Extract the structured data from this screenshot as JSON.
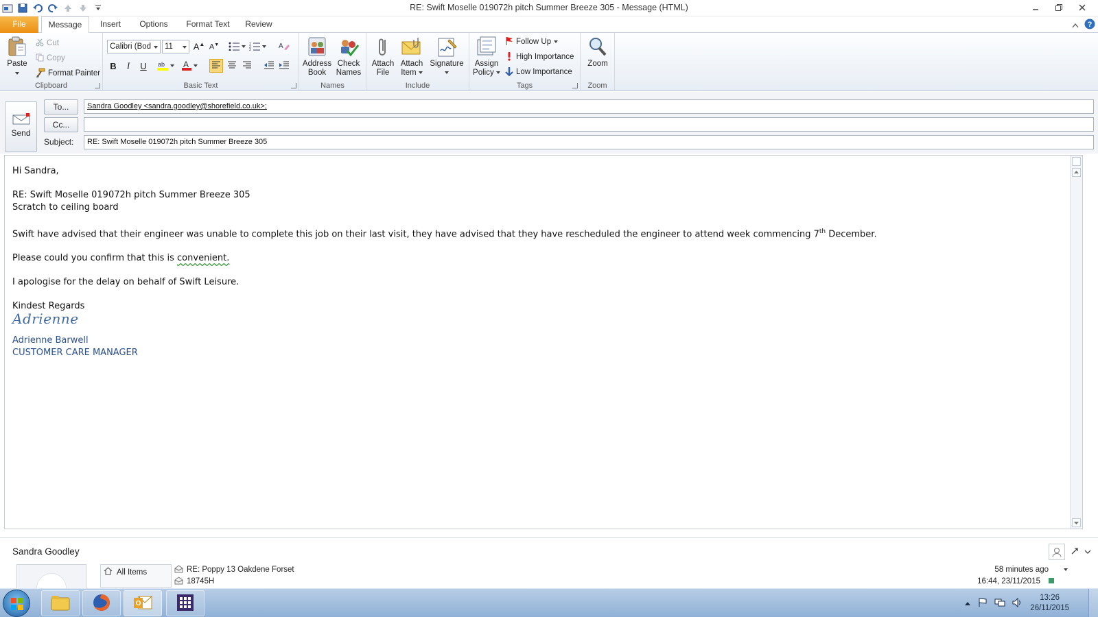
{
  "window": {
    "title": "RE: Swift Moselle 019072h pitch Summer Breeze 305  -  Message (HTML)",
    "controls": [
      "minimize",
      "restore",
      "close"
    ]
  },
  "quick_access": {
    "icons": [
      "outlook-icon",
      "save-icon",
      "undo-icon",
      "redo-icon",
      "previous-icon",
      "next-icon",
      "customize-icon"
    ]
  },
  "ribbon_tabs": [
    {
      "label": "File"
    },
    {
      "label": "Message",
      "active": true
    },
    {
      "label": "Insert"
    },
    {
      "label": "Options"
    },
    {
      "label": "Format Text"
    },
    {
      "label": "Review"
    }
  ],
  "clipboard": {
    "group": "Clipboard",
    "paste": "Paste",
    "cut": "Cut",
    "copy": "Copy",
    "format_painter": "Format Painter"
  },
  "basic_text": {
    "group": "Basic Text",
    "font": "Calibri (Bod",
    "size": "11"
  },
  "names": {
    "group": "Names",
    "address_book_1": "Address",
    "address_book_2": "Book",
    "check_names_1": "Check",
    "check_names_2": "Names"
  },
  "include": {
    "group": "Include",
    "attach_file_1": "Attach",
    "attach_file_2": "File",
    "attach_item_1": "Attach",
    "attach_item_2": "Item",
    "signature": "Signature"
  },
  "tags": {
    "group": "Tags",
    "assign_policy_1": "Assign",
    "assign_policy_2": "Policy",
    "follow_up": "Follow Up",
    "high_importance": "High Importance",
    "low_importance": "Low Importance"
  },
  "zoom": {
    "group": "Zoom",
    "label": "Zoom"
  },
  "compose": {
    "send": "Send",
    "to_button": "To...",
    "cc_button": "Cc...",
    "subject_label": "Subject:",
    "to_value": "Sandra Goodley <sandra.goodley@shorefield.co.uk>;",
    "cc_value": "",
    "subject_value": "RE: Swift Moselle 019072h pitch Summer Breeze 305"
  },
  "message_body": {
    "greeting": "Hi Sandra,",
    "ref_line": "RE: Swift Moselle 019072h pitch Summer Breeze 305",
    "issue_line": "Scratch to ceiling board",
    "para1_a": "Swift have advised that their engineer was unable to complete this job on their last visit, they have advised that they have rescheduled the engineer to attend week commencing 7",
    "para1_sup": "th",
    "para1_b": " December.",
    "para2_a": "Please could you confirm that this is ",
    "para2_flagged": "convenient.",
    "para3": "I apologise for the delay on behalf of Swift Leisure.",
    "closing": "Kindest Regards",
    "signature_script": "Adrienne",
    "signature_name": "Adrienne Barwell",
    "signature_title": "CUSTOMER CARE MANAGER"
  },
  "people_pane": {
    "name": "Sandra Goodley",
    "tab_all_items": "All Items",
    "items": [
      {
        "subject": "RE: Poppy 13 Oakdene Forset",
        "time": "58 minutes ago"
      },
      {
        "subject": "18745H",
        "time": "16:44, 23/11/2015"
      }
    ]
  },
  "taskbar": {
    "apps": [
      "windows-explorer-icon",
      "firefox-icon",
      "outlook-icon",
      "calendar-app-icon"
    ],
    "time": "13:26",
    "date": "26/11/2015"
  },
  "colors": {
    "file_tab": "#eb8f12",
    "signature_blue": "#2a4f8c",
    "taskbar": "#a7c2e0"
  }
}
